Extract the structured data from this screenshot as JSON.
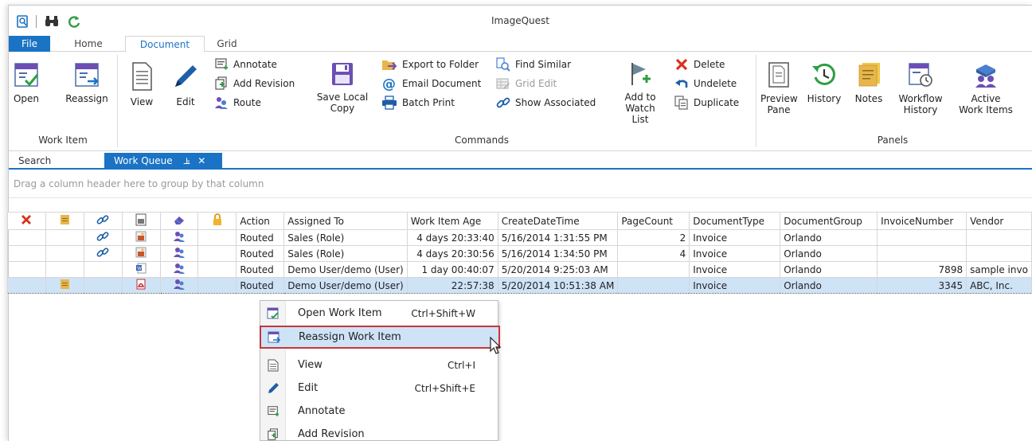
{
  "app": {
    "title": "ImageQuest"
  },
  "menu_tabs": [
    "File",
    "Home",
    "Document",
    "Grid"
  ],
  "ribbon": {
    "work_item": {
      "group": "Work Item",
      "open": "Open",
      "reassign": "Reassign"
    },
    "view": "View",
    "edit": "Edit",
    "annotate": "Annotate",
    "add_revision": "Add Revision",
    "route": "Route",
    "save_local_line1": "Save Local",
    "save_local_line2": "Copy",
    "export_to_folder": "Export to Folder",
    "email_document": "Email Document",
    "batch_print": "Batch Print",
    "find_similar": "Find Similar",
    "grid_edit": "Grid Edit",
    "show_associated": "Show Associated",
    "commands_group": "Commands",
    "add_watch_line1": "Add to",
    "add_watch_line2": "Watch List",
    "delete": "Delete",
    "undelete": "Undelete",
    "duplicate": "Duplicate",
    "preview_line1": "Preview",
    "preview_line2": "Pane",
    "history": "History",
    "notes": "Notes",
    "workflow_line1": "Workflow",
    "workflow_line2": "History",
    "active_line1": "Active",
    "active_line2": "Work Items",
    "panels_group": "Panels"
  },
  "doc_tabs": {
    "search": "Search",
    "work_queue": "Work Queue"
  },
  "grid": {
    "group_hint": "Drag a column header here to group by that column",
    "headers": {
      "action": "Action",
      "assigned_to": "Assigned To",
      "age": "Work Item Age",
      "created": "CreateDateTime",
      "pages": "PageCount",
      "doctype": "DocumentType",
      "docgroup": "DocumentGroup",
      "invoice": "InvoiceNumber",
      "vendor": "Vendor"
    },
    "rows": [
      {
        "action": "Routed",
        "assigned": "Sales (Role)",
        "age": "4 days 20:33:40",
        "created": "5/16/2014 1:31:55 PM",
        "pages": "2",
        "doctype": "Invoice",
        "docgroup": "Orlando",
        "invoice": "",
        "vendor": ""
      },
      {
        "action": "Routed",
        "assigned": "Sales (Role)",
        "age": "4 days 20:30:56",
        "created": "5/16/2014 1:34:50 PM",
        "pages": "4",
        "doctype": "Invoice",
        "docgroup": "Orlando",
        "invoice": "",
        "vendor": ""
      },
      {
        "action": "Routed",
        "assigned": "Demo User/demo (User)",
        "age": "1 day 00:40:07",
        "created": "5/20/2014 9:25:03 AM",
        "pages": "",
        "doctype": "Invoice",
        "docgroup": "Orlando",
        "invoice": "7898",
        "vendor": "sample invo"
      },
      {
        "action": "Routed",
        "assigned": "Demo User/demo (User)",
        "age": "22:57:38",
        "created": "5/20/2014 10:51:38 AM",
        "pages": "",
        "doctype": "Invoice",
        "docgroup": "Orlando",
        "invoice": "3345",
        "vendor": "ABC, Inc."
      }
    ]
  },
  "context_menu": {
    "open": {
      "label": "Open Work Item",
      "shortcut": "Ctrl+Shift+W"
    },
    "reassign": {
      "label": "Reassign Work Item"
    },
    "view": {
      "label": "View",
      "shortcut": "Ctrl+I"
    },
    "edit": {
      "label": "Edit",
      "shortcut": "Ctrl+Shift+E"
    },
    "annotate": {
      "label": "Annotate"
    },
    "add_revision": {
      "label": "Add Revision"
    }
  },
  "colors": {
    "accent": "#1a73c4",
    "highlight": "#cfe3f7",
    "callout": "#c6363b"
  }
}
